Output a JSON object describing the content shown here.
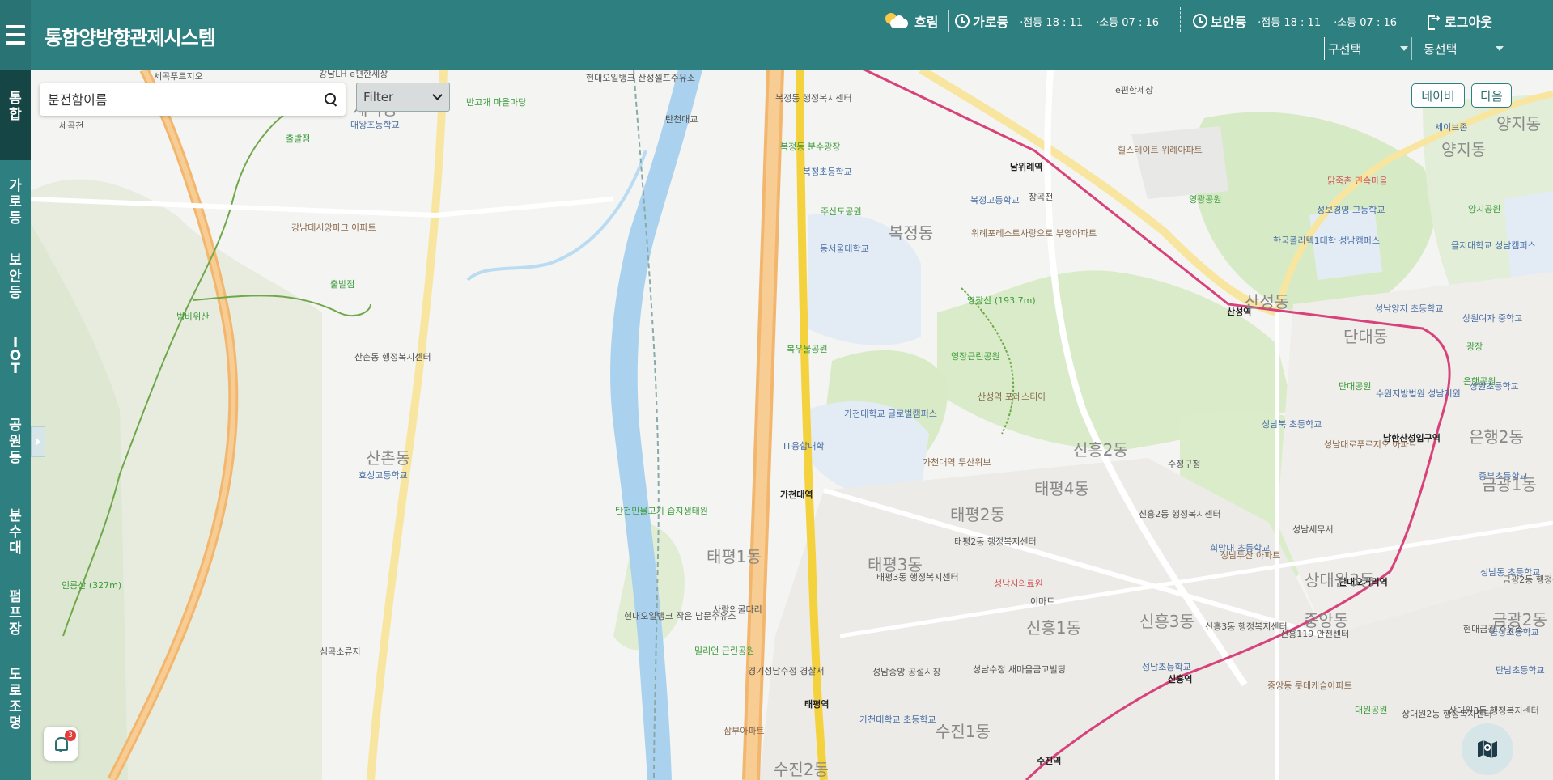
{
  "header": {
    "title": "통합양방향관제시스템",
    "weather": {
      "icon": "cloudy-sun-icon",
      "label": "흐림"
    },
    "street_lamp": {
      "title": "가로등",
      "on_time": "·점등 18 : 11",
      "off_time": "·소등 07 : 16"
    },
    "security_lamp": {
      "title": "보안등",
      "on_time": "·점등 18 : 11",
      "off_time": "·소등 07 : 16"
    },
    "logout_label": "로그아웃",
    "gu_select": "구선택",
    "dong_select": "동선택"
  },
  "sidebar": {
    "items": [
      {
        "id": "integrated",
        "chars": [
          "통",
          "합"
        ],
        "active": true
      },
      {
        "id": "street-lamp",
        "chars": [
          "가",
          "로",
          "등"
        ],
        "active": false
      },
      {
        "id": "security-lamp",
        "chars": [
          "보",
          "안",
          "등"
        ],
        "active": false
      },
      {
        "id": "iot",
        "chars": [
          "I",
          "O",
          "T"
        ],
        "active": false
      },
      {
        "id": "park-lamp",
        "chars": [
          "공",
          "원",
          "등"
        ],
        "active": false
      },
      {
        "id": "fountain",
        "chars": [
          "분",
          "수",
          "대"
        ],
        "active": false
      },
      {
        "id": "pump",
        "chars": [
          "펌",
          "프",
          "장"
        ],
        "active": false
      },
      {
        "id": "road-light",
        "chars": [
          "도",
          "로",
          "조",
          "명"
        ],
        "active": false
      }
    ]
  },
  "search": {
    "placeholder": "분전함이름",
    "filter_label": "Filter"
  },
  "map_buttons": {
    "naver": "네이버",
    "daum": "다음"
  },
  "notifications": {
    "count": "3"
  },
  "map": {
    "labels": [
      {
        "text": "세곡푸르지오",
        "cls": ""
      },
      {
        "text": "강남LH e편한세상",
        "cls": ""
      },
      {
        "text": "세곡동",
        "cls": "big"
      },
      {
        "text": "대왕초등학교",
        "cls": "blue"
      },
      {
        "text": "세곡천",
        "cls": ""
      },
      {
        "text": "출발점",
        "cls": "green"
      },
      {
        "text": "강남데시앙파크 아파트",
        "cls": "brown"
      },
      {
        "text": "출발점",
        "cls": "green"
      },
      {
        "text": "범바위산",
        "cls": "green"
      },
      {
        "text": "산촌동 행정복지센터",
        "cls": ""
      },
      {
        "text": "산촌동",
        "cls": "big"
      },
      {
        "text": "효성고등학교",
        "cls": "blue"
      },
      {
        "text": "인릉산 (327m)",
        "cls": "green"
      },
      {
        "text": "심곡소류지",
        "cls": ""
      },
      {
        "text": "현대오일뱅크 산성셀프주유소",
        "cls": ""
      },
      {
        "text": "반고개 마을마당",
        "cls": "green"
      },
      {
        "text": "탄천대교",
        "cls": ""
      },
      {
        "text": "탄천민물고기 습지생태원",
        "cls": "green"
      },
      {
        "text": "복정동 행정복지센터",
        "cls": ""
      },
      {
        "text": "복정동 분수광장",
        "cls": "green"
      },
      {
        "text": "복정초등학교",
        "cls": "blue"
      },
      {
        "text": "주산도공원",
        "cls": "green"
      },
      {
        "text": "동서울대학교",
        "cls": "blue"
      },
      {
        "text": "복정동",
        "cls": "big"
      },
      {
        "text": "복우물공원",
        "cls": "green"
      },
      {
        "text": "가천대학교 글로벌캠퍼스",
        "cls": "blue"
      },
      {
        "text": "IT융합대학",
        "cls": "blue"
      },
      {
        "text": "가천대역",
        "cls": "station"
      },
      {
        "text": "영장산 (193.7m)",
        "cls": "green"
      },
      {
        "text": "가천대역 두산위브",
        "cls": "brown"
      },
      {
        "text": "태평1동",
        "cls": "big"
      },
      {
        "text": "태평2동",
        "cls": "big"
      },
      {
        "text": "태평3동",
        "cls": "big"
      },
      {
        "text": "태평4동",
        "cls": "big"
      },
      {
        "text": "태평2동 행정복지센터",
        "cls": ""
      },
      {
        "text": "태평3동 행정복지센터",
        "cls": ""
      },
      {
        "text": "성남시의료원",
        "cls": "red"
      },
      {
        "text": "이마트",
        "cls": ""
      },
      {
        "text": "사랑의굴다리",
        "cls": ""
      },
      {
        "text": "밀리언 근린공원",
        "cls": "green"
      },
      {
        "text": "경기성남수정 경찰서",
        "cls": ""
      },
      {
        "text": "성남중앙 공설시장",
        "cls": ""
      },
      {
        "text": "성남수정 새마을금고빌딩",
        "cls": ""
      },
      {
        "text": "신흥1동",
        "cls": "big"
      },
      {
        "text": "신흥2동",
        "cls": "big"
      },
      {
        "text": "신흥3동",
        "cls": "big"
      },
      {
        "text": "수진1동",
        "cls": "big"
      },
      {
        "text": "태평역",
        "cls": "station"
      },
      {
        "text": "신흥역",
        "cls": "station"
      },
      {
        "text": "수진역",
        "cls": "station"
      },
      {
        "text": "삼부아파트",
        "cls": "brown"
      },
      {
        "text": "남위례역",
        "cls": "station"
      },
      {
        "text": "창곡천",
        "cls": ""
      },
      {
        "text": "복정고등학교",
        "cls": "blue"
      },
      {
        "text": "위례포레스트사랑으로 부영아파트",
        "cls": "brown"
      },
      {
        "text": "힐스테이트 위례아파트",
        "cls": "brown"
      },
      {
        "text": "e편한세상",
        "cls": ""
      },
      {
        "text": "산성역",
        "cls": "station"
      },
      {
        "text": "산성동",
        "cls": "big"
      },
      {
        "text": "영장근린공원",
        "cls": "green"
      },
      {
        "text": "산성역 포레스티아",
        "cls": "brown"
      },
      {
        "text": "영광공원",
        "cls": "green"
      },
      {
        "text": "한국폴리텍1대학 성남캠퍼스",
        "cls": "blue"
      },
      {
        "text": "닭죽촌 민속마을",
        "cls": "red"
      },
      {
        "text": "성보경영 고등학교",
        "cls": "blue"
      },
      {
        "text": "단대동",
        "cls": "big"
      },
      {
        "text": "단대공원",
        "cls": "green"
      },
      {
        "text": "수원지방법원 성남지원",
        "cls": "blue"
      },
      {
        "text": "남한산성입구역",
        "cls": "station"
      },
      {
        "text": "단대오거리역",
        "cls": "station"
      },
      {
        "text": "성남대로푸르지오 아파트",
        "cls": "brown"
      },
      {
        "text": "성남세무서",
        "cls": ""
      },
      {
        "text": "성남두산 아파트",
        "cls": "brown"
      },
      {
        "text": "희망대 초등학교",
        "cls": "blue"
      },
      {
        "text": "신흥3동 행정복지센터",
        "cls": ""
      },
      {
        "text": "신흥2동 행정복지센터",
        "cls": ""
      },
      {
        "text": "성남북 초등학교",
        "cls": "blue"
      },
      {
        "text": "수정구청",
        "cls": ""
      },
      {
        "text": "성남초등학교",
        "cls": "blue"
      },
      {
        "text": "신흥119 안전센터",
        "cls": ""
      },
      {
        "text": "중앙동",
        "cls": "big"
      },
      {
        "text": "중앙동 롯데캐슬아파트",
        "cls": "brown"
      },
      {
        "text": "대원공원",
        "cls": "green"
      },
      {
        "text": "상대원2동 행정복지센터",
        "cls": ""
      },
      {
        "text": "상대원3동",
        "cls": "big"
      },
      {
        "text": "세이브존",
        "cls": "blue"
      },
      {
        "text": "양지동",
        "cls": "big"
      },
      {
        "text": "양지공원",
        "cls": "green"
      },
      {
        "text": "을지대학교 성남캠퍼스",
        "cls": "blue"
      },
      {
        "text": "성남양지 초등학교",
        "cls": "blue"
      },
      {
        "text": "상원여자 중학교",
        "cls": "blue"
      },
      {
        "text": "광장",
        "cls": "green"
      },
      {
        "text": "은행공원",
        "cls": "green"
      },
      {
        "text": "상원초등학교",
        "cls": "blue"
      },
      {
        "text": "은행2동",
        "cls": "big"
      },
      {
        "text": "중부초등학교",
        "cls": "blue"
      },
      {
        "text": "금광1동",
        "cls": "big"
      },
      {
        "text": "성남동 초등학교",
        "cls": "blue"
      },
      {
        "text": "금광2동 행정복지센터",
        "cls": ""
      },
      {
        "text": "금광2동",
        "cls": "big"
      },
      {
        "text": "금상초등학교",
        "cls": "blue"
      },
      {
        "text": "현대금광 주유소",
        "cls": ""
      },
      {
        "text": "단남초등학교",
        "cls": "blue"
      },
      {
        "text": "상대원3동 행정복지센터",
        "cls": ""
      },
      {
        "text": "현대오일뱅크 작은 남문주유소",
        "cls": ""
      },
      {
        "text": "수진2동",
        "cls": "big"
      },
      {
        "text": "가천대학교 초등학교",
        "cls": "blue"
      },
      {
        "text": "양지동",
        "cls": "big"
      }
    ]
  }
}
